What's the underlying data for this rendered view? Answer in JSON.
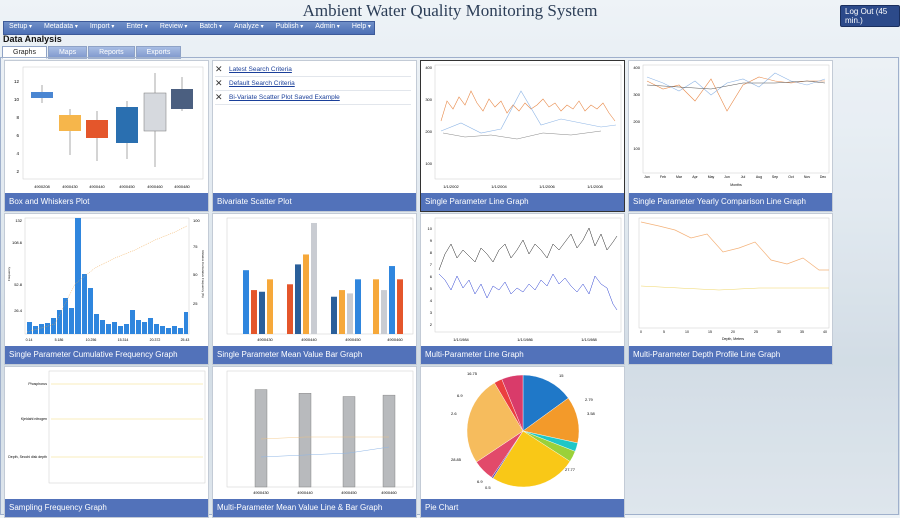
{
  "app": {
    "title": "Ambient Water Quality Monitoring System",
    "logout_label": "Log Out (45 min.)"
  },
  "menu": [
    "Setup",
    "Metadata",
    "Import",
    "Enter",
    "Review",
    "Batch",
    "Analyze",
    "Publish",
    "Admin",
    "Help"
  ],
  "page": {
    "section_title": "Data Analysis"
  },
  "tabs": [
    "Graphs",
    "Maps",
    "Reports",
    "Exports"
  ],
  "searches": [
    "Latest Search Criteria",
    "Default Search Criteria",
    "Bi-Variate Scatter Plot Saved Example"
  ],
  "tiles": [
    {
      "caption": "Box and Whiskers Plot"
    },
    {
      "caption": "Bivariate Scatter Plot"
    },
    {
      "caption": "Single Parameter Line Graph"
    },
    {
      "caption": "Single Parameter Yearly Comparison Line Graph"
    },
    {
      "caption": "Single Parameter Cumulative Frequency Graph"
    },
    {
      "caption": "Single Parameter Mean Value Bar Graph"
    },
    {
      "caption": "Multi-Parameter Line Graph"
    },
    {
      "caption": "Multi-Parameter Depth Profile Line Graph"
    },
    {
      "caption": "Sampling Frequency Graph"
    },
    {
      "caption": "Multi-Parameter Mean Value Line & Bar Graph"
    },
    {
      "caption": "Pie Chart"
    }
  ],
  "chart_text": {
    "box": {
      "yticks": [
        "12",
        "10",
        "8",
        "6",
        "4",
        "2"
      ],
      "xlabels": [
        "4900208",
        "4900430",
        "4900440",
        "4900450",
        "4900460",
        "4900480"
      ]
    },
    "line": {
      "yticks": [
        "400",
        "300",
        "200",
        "100"
      ],
      "xlabels": [
        "1/1/2002",
        "1/1/2004",
        "1/1/2006",
        "1/1/2008"
      ]
    },
    "yearly": {
      "yticks": [
        "400",
        "300",
        "200",
        "100"
      ],
      "months": [
        "Jan",
        "Feb",
        "Mar",
        "Apr",
        "May",
        "Jun",
        "Jul",
        "Aug",
        "Sep",
        "Oct",
        "Nov",
        "Dec"
      ],
      "xlabel": "Months"
    },
    "cumfreq": {
      "yticks_left": [
        "132",
        "108.6",
        "52.8",
        "26.4"
      ],
      "yticks_right": [
        "100",
        "75",
        "50",
        "25"
      ],
      "xlabels": [
        "0.14",
        "5.186",
        "10.256",
        "15.314",
        "20.372",
        "25.43"
      ],
      "ylabel_left": "Frequency",
      "ylabel_right": "Relative Cumulative Frequency (%)"
    },
    "meanbar": {
      "xlabels": [
        "4900430",
        "4900440",
        "4900450",
        "4900460"
      ]
    },
    "multiline": {
      "yticks": [
        "10",
        "9",
        "8",
        "7",
        "6",
        "5",
        "4",
        "3",
        "2"
      ],
      "xlabels": [
        "1/1/1984",
        "1/1/1986",
        "1/1/1988"
      ]
    },
    "depth": {
      "xlabel": "Depth, Meters",
      "xticks": [
        "0",
        "5",
        "10",
        "15",
        "20",
        "25",
        "30",
        "35",
        "40"
      ]
    },
    "samplefreq": {
      "labels": [
        "Phosphorus",
        "Kjeldahl nitrogen",
        "Depth, Secchi disk depth"
      ]
    },
    "meanlinebar": {
      "xlabels": [
        "4900430",
        "4900440",
        "4900450",
        "4900460"
      ]
    },
    "pie": {
      "labels": [
        "16.75",
        "15",
        "2.79",
        "3.58",
        "6.9",
        "2.6",
        "28.85",
        "27.77",
        "6.9",
        "0.5"
      ]
    }
  },
  "chart_data": [
    {
      "type": "bar",
      "title": "",
      "categories": [
        "4900208",
        "4900430",
        "4900440",
        "4900450",
        "4900460",
        "4900480"
      ],
      "series": [
        {
          "values": [
            10.2,
            7.2,
            6.6,
            7.2,
            8.6,
            10
          ]
        }
      ]
    },
    {
      "type": "bar",
      "title": "",
      "categories": [
        "4900430",
        "4900440",
        "4900450",
        "4900460"
      ],
      "series": [
        {
          "values": [
            7.7,
            6,
            4.5,
            6.6
          ]
        },
        {
          "values": [
            5.3,
            8.4,
            5.3,
            5.3
          ]
        },
        {
          "values": [
            5.1,
            9.6,
            4.9,
            8.2
          ]
        },
        {
          "values": [
            6.6,
            13.4,
            6.6,
            6.6
          ]
        }
      ],
      "ylim": [
        0,
        14
      ]
    },
    {
      "type": "bar",
      "title": "",
      "categories": [
        "4900430",
        "4900440",
        "4900450",
        "4900460"
      ],
      "values": [
        21,
        20.2,
        19.5,
        19.8
      ],
      "ylim": [
        0,
        25
      ]
    },
    {
      "type": "pie",
      "title": "",
      "categories": [
        "16.75",
        "15",
        "2.79",
        "3.58",
        "27.77",
        "0.5",
        "6.9",
        "28.85",
        "2.6",
        "6.9"
      ],
      "values": [
        16.75,
        15,
        2.79,
        3.58,
        27.77,
        0.5,
        6.9,
        28.85,
        2.6,
        6.9
      ],
      "colors": [
        "#1f78c8",
        "#f39a2a",
        "#1fc7c7",
        "#9ad13a",
        "#f9c817",
        "#5c4bb3",
        "#e24a6a",
        "#f6bc5d",
        "#eb3f3f",
        "#d93b6a"
      ]
    }
  ]
}
